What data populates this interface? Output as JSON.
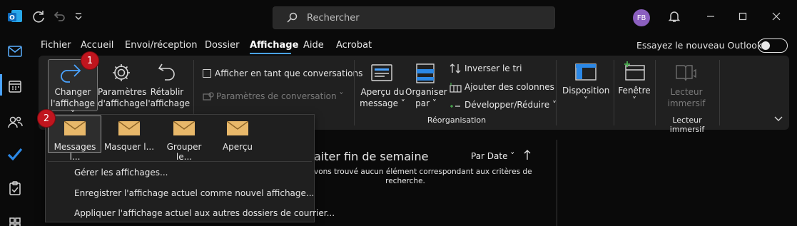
{
  "titlebar": {
    "search_placeholder": "Rechercher",
    "avatar_initials": "FB"
  },
  "menu": {
    "tabs": [
      "Fichier",
      "Accueil",
      "Envoi/réception",
      "Dossier",
      "Affichage",
      "Aide",
      "Acrobat"
    ],
    "active": "Affichage",
    "try_new_label": "Essayez le nouveau Outlook"
  },
  "ribbon": {
    "changer": {
      "line1": "Changer",
      "line2": "l'affichage ˅"
    },
    "parametres": {
      "line1": "Paramètres",
      "line2": "d'affichage"
    },
    "retablir": {
      "line1": "Rétablir",
      "line2": "l'affichage"
    },
    "conversations_checkbox": "Afficher en tant que conversations",
    "conversation_params": "Paramètres de conversation ˅",
    "apercu": {
      "line1": "Aperçu du",
      "line2": "message ˅"
    },
    "organiser": {
      "line1": "Organiser",
      "line2": "par ˅"
    },
    "inverser": "Inverser le tri",
    "ajouter_colonnes": "Ajouter des colonnes",
    "developper": "Développer/Réduire ˅",
    "reorganisation_group": "Réorganisation",
    "disposition": "Disposition",
    "fenetre": "Fenêtre",
    "lecteur": {
      "line1": "Lecteur",
      "line2": "immersif"
    },
    "lecteur_group": "Lecteur immersif"
  },
  "dropdown": {
    "views": [
      "Messages l...",
      "Masquer l...",
      "Grouper le...",
      "Aperçu"
    ],
    "selected_view": "Messages l...",
    "links": [
      "Gérer les affichages...",
      "Enregistrer l'affichage actuel comme nouvel affichage...",
      "Appliquer l'affichage actuel aux autres dossiers de courrier..."
    ]
  },
  "content": {
    "heading": "aiter fin de semaine",
    "sort_label": "Par Date ˅",
    "empty_line1": "vons trouvé aucun élément correspondant aux critères de",
    "empty_line2": "recherche."
  },
  "badges": [
    "1",
    "2"
  ],
  "colors": {
    "accent": "#4aa3ff",
    "badge": "#c0151e",
    "outlook_blue": "#0f6cbd"
  }
}
